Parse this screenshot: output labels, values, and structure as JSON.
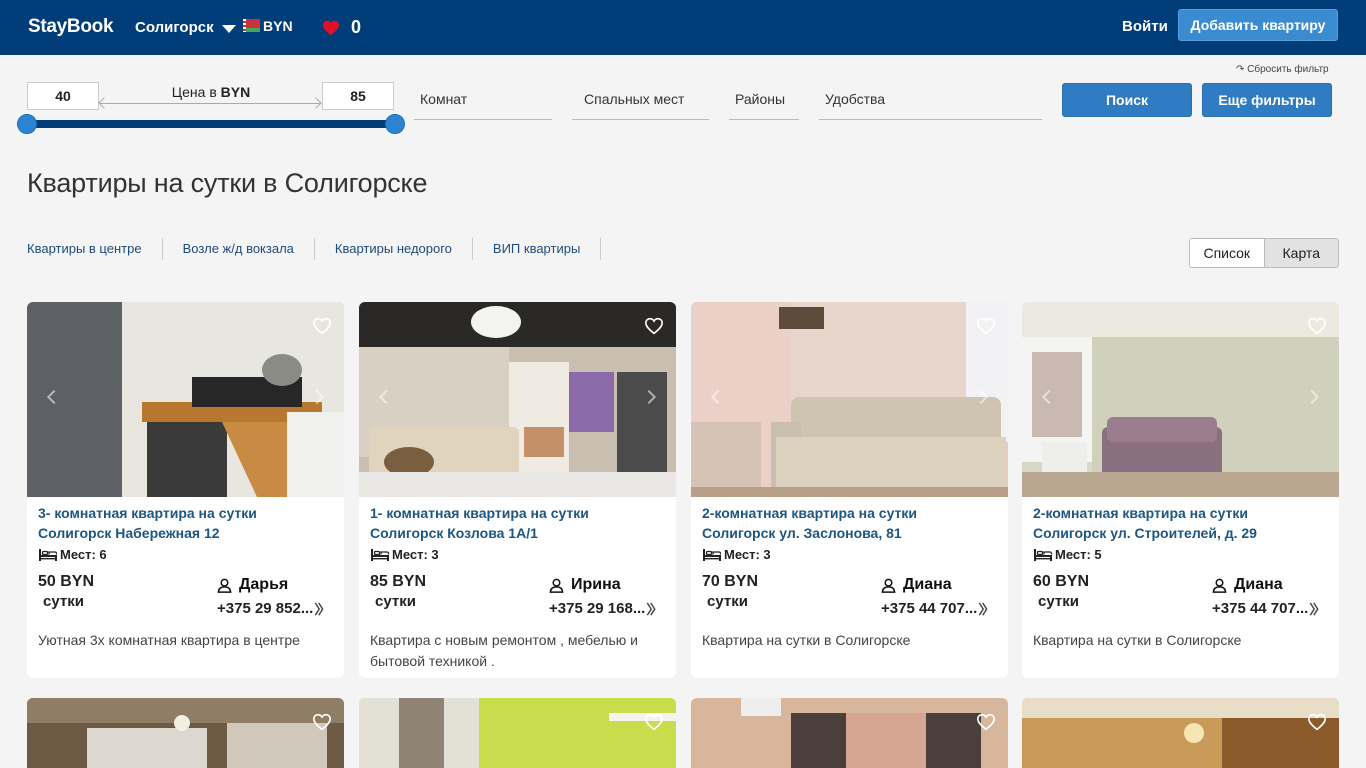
{
  "header": {
    "logo": "StayBook",
    "city": "Солигорск",
    "currency": "BYN",
    "favorites_count": "0",
    "login": "Войти",
    "add_apartment": "Добавить квартиру"
  },
  "filters": {
    "price_min": "40",
    "price_max": "85",
    "price_label": "Цена в",
    "price_currency": "BYN",
    "rooms": "Комнат",
    "sleeping_places": "Спальных мест",
    "districts": "Районы",
    "amenities": "Удобства",
    "reset": "↷ Сбросить фильтр",
    "search": "Поиск",
    "more_filters": "Еще фильтры"
  },
  "page_title": "Квартиры на сутки в Солигорске",
  "quick_links": [
    "Квартиры в центре",
    "Возле ж/д вокзала",
    "Квартиры недорого",
    "ВИП квартиры"
  ],
  "view_toggle": {
    "list": "Список",
    "map": "Карта"
  },
  "listings": [
    {
      "title_line1": "3- комнатная квартира на сутки",
      "title_line2": "Солигорск Набережная 12",
      "places": "Мест: 6",
      "price": "50 BYN",
      "per": "сутки",
      "owner": "Дарья",
      "phone": "+375 29 852...",
      "description": "Уютная 3х комнатная квартира в центре"
    },
    {
      "title_line1": "1- комнатная квартира на сутки",
      "title_line2": "Солигорск Козлова 1А/1",
      "places": "Мест: 3",
      "price": "85 BYN",
      "per": "сутки",
      "owner": "Ирина",
      "phone": "+375 29 168...",
      "description": "Квартира с новым ремонтом , мебелью и бытовой техникой ."
    },
    {
      "title_line1": "2-комнатная квартира на сутки",
      "title_line2": "Солигорск ул. Заслонова, 81",
      "places": "Мест: 3",
      "price": "70 BYN",
      "per": "сутки",
      "owner": "Диана",
      "phone": "+375 44 707...",
      "description": "Квартира на сутки в Солигорске"
    },
    {
      "title_line1": "2-комнатная квартира на сутки",
      "title_line2": "Солигорск ул. Строителей, д. 29",
      "places": "Мест: 5",
      "price": "60 BYN",
      "per": "сутки",
      "owner": "Диана",
      "phone": "+375 44 707...",
      "description": "Квартира на сутки в Солигорске"
    }
  ],
  "colors": {
    "header_bg": "#003d79",
    "accent_button": "#2f7cc3",
    "listing_title": "#1d5680",
    "favorite_heart": "#e0102a"
  },
  "icons": [
    "heart-icon",
    "bed-icon",
    "person-icon",
    "caret-down-icon",
    "double-chevron-right-icon"
  ]
}
